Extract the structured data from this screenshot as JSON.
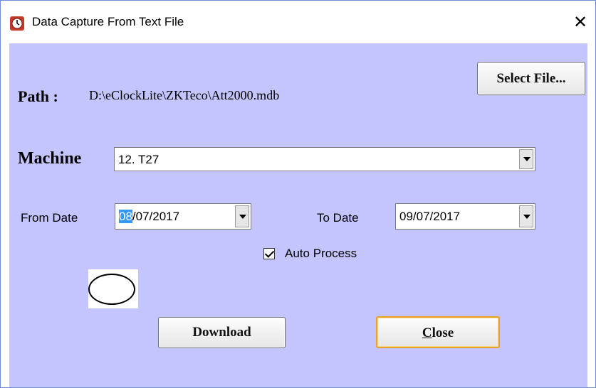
{
  "window": {
    "title": "Data Capture From Text File",
    "close_glyph": "✕",
    "icon": "clock-icon"
  },
  "path": {
    "label": "Path :",
    "value": "D:\\eClockLite\\ZKTeco\\Att2000.mdb",
    "select_button": "Select File..."
  },
  "machine": {
    "label": "Machine",
    "selected": "12. T27"
  },
  "dates": {
    "from_label": "From Date",
    "from_selected_part": "08",
    "from_rest": "/07/2017",
    "to_label": "To Date",
    "to_value": "09/07/2017"
  },
  "auto_process": {
    "label": "Auto Process",
    "checked": true
  },
  "buttons": {
    "download": "Download",
    "close_first": "C",
    "close_rest": "lose"
  },
  "colors": {
    "client_background": "#c4c4ff",
    "selection_highlight": "#3399ff",
    "default_button_border": "#e8a227"
  }
}
